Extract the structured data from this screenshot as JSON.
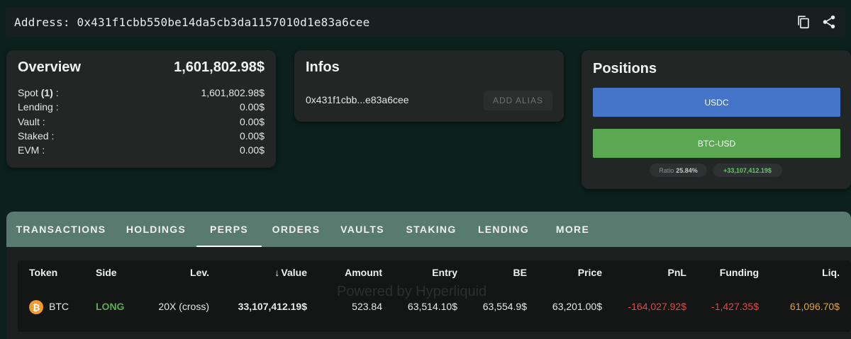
{
  "address_bar": {
    "text": "Address: 0x431f1cbb550be14da5cb3da1157010d1e83a6cee",
    "icons": [
      "copy-icon",
      "share-icon"
    ]
  },
  "overview": {
    "title": "Overview",
    "total": "1,601,802.98$",
    "rows": [
      {
        "label_pre": "Spot ",
        "label_bold": "(1)",
        "label_post": " :",
        "value": "1,601,802.98$"
      },
      {
        "label_pre": "Lending :",
        "label_bold": "",
        "label_post": "",
        "value": "0.00$"
      },
      {
        "label_pre": "Vault :",
        "label_bold": "",
        "label_post": "",
        "value": "0.00$"
      },
      {
        "label_pre": "Staked :",
        "label_bold": "",
        "label_post": "",
        "value": "0.00$"
      },
      {
        "label_pre": "EVM :",
        "label_bold": "",
        "label_post": "",
        "value": "0.00$"
      }
    ]
  },
  "infos": {
    "title": "Infos",
    "short_address": "0x431f1cbb...e83a6cee",
    "add_alias_label": "ADD ALIAS"
  },
  "positions": {
    "title": "Positions",
    "bars": [
      {
        "label": "USDC",
        "color": "#4475c9"
      },
      {
        "label": "BTC-USD",
        "color": "#5aa952"
      }
    ],
    "ratio_label": "Ratio",
    "ratio_value": "25.84%",
    "value": "+33,107,412.19$"
  },
  "tabs": [
    "TRANSACTIONS",
    "HOLDINGS",
    "PERPS",
    "ORDERS",
    "VAULTS",
    "STAKING",
    "LENDING",
    "MORE"
  ],
  "active_tab": "PERPS",
  "table": {
    "headers": [
      "Token",
      "Side",
      "Lev.",
      "Value",
      "Amount",
      "Entry",
      "BE",
      "Price",
      "PnL",
      "Funding",
      "Liq."
    ],
    "sort_indicator": "↓",
    "watermark": "Powered by Hyperliquid",
    "rows": [
      {
        "token_icon": "bitcoin-icon",
        "token_symbol_glyph": "₿",
        "token": "BTC",
        "side": "LONG",
        "lev": "20X (cross)",
        "value": "33,107,412.19$",
        "amount": "523.84",
        "entry": "63,514.10$",
        "be": "63,554.9$",
        "price": "63,201.00$",
        "pnl": "-164,027.92$",
        "funding": "-1,427.35$",
        "liq": "61,096.70$"
      }
    ]
  },
  "colors": {
    "background": "#0c201c",
    "card": "#222625",
    "tab_bar": "#587a6f",
    "long": "#5caa51",
    "negative": "#e04a42",
    "liq": "#e5a33a",
    "usdc_bar": "#4475c9",
    "btc_bar": "#5aa952"
  }
}
